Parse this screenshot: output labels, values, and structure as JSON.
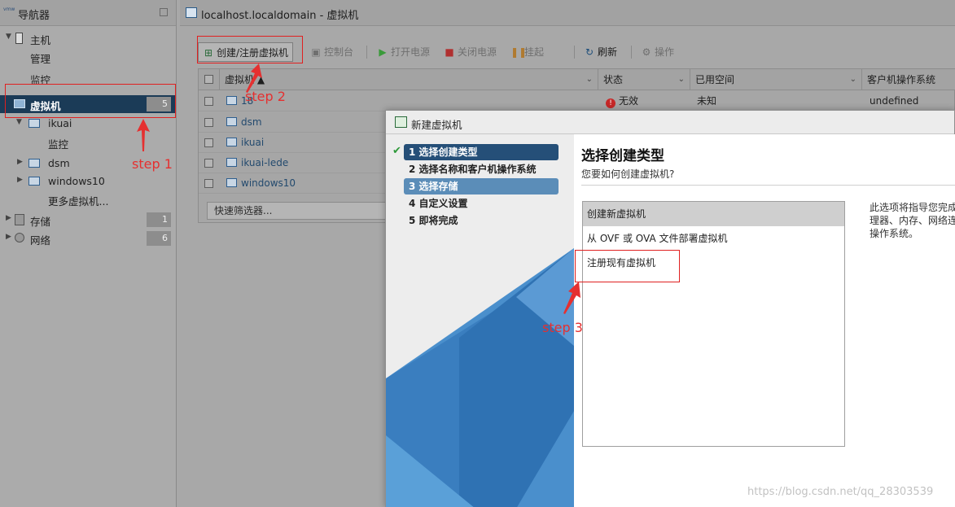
{
  "navigator": {
    "title": "导航器",
    "logo_text": "vmw",
    "items": [
      {
        "label": "主机"
      },
      {
        "label": "管理"
      },
      {
        "label": "监控"
      },
      {
        "label": "虚拟机",
        "count": "5"
      },
      {
        "label": "ikuai"
      },
      {
        "label": "监控"
      },
      {
        "label": "dsm"
      },
      {
        "label": "windows10"
      },
      {
        "label": "更多虚拟机..."
      },
      {
        "label": "存储",
        "count": "1"
      },
      {
        "label": "网络",
        "count": "6"
      }
    ]
  },
  "main": {
    "title": "localhost.localdomain - 虚拟机",
    "toolbar": {
      "create": "创建/注册虚拟机",
      "console": "控制台",
      "power_on": "打开电源",
      "power_off": "关闭电源",
      "suspend": "挂起",
      "refresh": "刷新",
      "actions": "操作"
    },
    "grid": {
      "headers": [
        "虚拟机 ▲",
        "状态",
        "已用空间",
        "客户机操作系统"
      ],
      "rows": [
        {
          "name": "18",
          "status": "无效",
          "used": "未知",
          "os": "undefined"
        },
        {
          "name": "dsm"
        },
        {
          "name": "ikuai"
        },
        {
          "name": "ikuai-lede"
        },
        {
          "name": "windows10"
        }
      ],
      "filter_placeholder": "快速筛选器..."
    }
  },
  "dialog": {
    "title": "新建虚拟机",
    "steps": [
      "1 选择创建类型",
      "2 选择名称和客户机操作系统",
      "3 选择存储",
      "4 自定义设置",
      "5 即将完成"
    ],
    "heading": "选择创建类型",
    "subheading": "您要如何创建虚拟机?",
    "options": [
      "创建新虚拟机",
      "从 OVF 或 OVA 文件部署虚拟机",
      "注册现有虚拟机"
    ],
    "description": "此选项将指导您完成 理器、内存、网络连 操作系统。"
  },
  "annotations": {
    "step1": "step 1",
    "step2": "step 2",
    "step3": "step 3"
  },
  "watermark": "https://blog.csdn.net/qq_28303539",
  "colors": {
    "annotation_red": "#e02020",
    "nav_selected": "#1b3b57",
    "step_current": "#254f78",
    "step_selected": "#5b8db8"
  }
}
